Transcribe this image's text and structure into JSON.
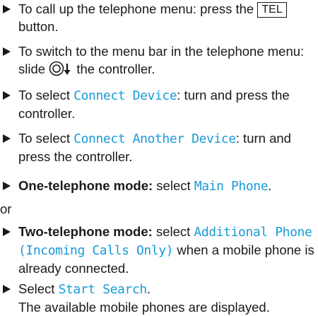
{
  "steps": [
    {
      "text_a": "To call up the telephone menu: press the ",
      "key": "TEL",
      "text_b": " button."
    },
    {
      "text_a": "To switch to the menu bar in the telephone menu: slide ",
      "icon": "controller-slide-down-icon",
      "text_b": " the controller."
    },
    {
      "text_a": "To select ",
      "mono": "Connect Device",
      "text_b": ": turn and press the controller."
    },
    {
      "text_a": "To select ",
      "mono": "Connect Another Device",
      "text_b": ": turn and press the controller."
    },
    {
      "bold": "One-telephone mode:",
      "text_a": " select ",
      "mono": "Main Phone",
      "text_b": "."
    },
    {
      "bold": "Two-telephone mode:",
      "text_a": " select ",
      "mono": "Additional Phone (Incoming Calls Only)",
      "text_b": " when a mobile phone is already connected."
    },
    {
      "text_a": "Select ",
      "mono": "Start Search",
      "text_b": ".",
      "line2": "The available mobile phones are displayed."
    }
  ],
  "or_label": "or",
  "colors": {
    "menu_text": "#1a9bd7",
    "body_text": "#1a1a1a"
  }
}
